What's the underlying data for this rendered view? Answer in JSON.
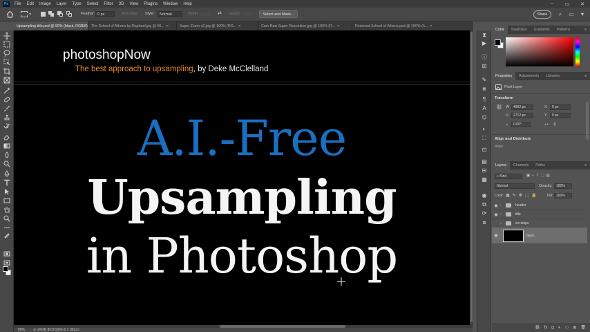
{
  "app": {
    "logo": "Ps"
  },
  "menubar": {
    "items": [
      "File",
      "Edit",
      "Image",
      "Layer",
      "Type",
      "Select",
      "Filter",
      "3D",
      "View",
      "Plugins",
      "Window",
      "Help"
    ]
  },
  "options": {
    "feather_label": "Feather:",
    "feather_value": "0 px",
    "antialias_label": "Anti-alias",
    "style_label": "Style:",
    "style_value": "Normal",
    "width_label": "Width:",
    "height_label": "Height:",
    "select_mask": "Select and Mask...",
    "share": "Share"
  },
  "tabs": [
    {
      "label": "Upsampling title.psd @ 50% (black, RGB/8)",
      "active": true
    },
    {
      "label": "The School of Athens by Raphael.jpg @ 66...",
      "active": false
    },
    {
      "label": "Super Zoom x2.jpg @ 100% (RG...",
      "active": false
    },
    {
      "label": "Cam Raw Super Resolution.jpg @ 100% (R...",
      "active": false
    },
    {
      "label": "Restored School of Athens.psd @ 100% (h...",
      "active": false
    }
  ],
  "canvas": {
    "brand": "photoshopNow",
    "tagline_orange": "The best approach to upsampling",
    "tagline_rest": ", by Deke McClelland",
    "headline1": "A.I.-Free",
    "headline2": "Upsampling",
    "headline3": "in Photoshop"
  },
  "status": {
    "zoom": "50%",
    "info": "◎ sRGB IEC61966-2.1 (8bpc)"
  },
  "color_panel": {
    "tabs": [
      "Color",
      "Swatches",
      "Gradients",
      "Patterns"
    ]
  },
  "properties_panel": {
    "tabs": [
      "Properties",
      "Adjustments",
      "Libraries"
    ],
    "type": "Pixel Layer",
    "transform_title": "Transform",
    "w_label": "W",
    "w_value": "4992 px",
    "h_label": "H",
    "h_value": "2712 px",
    "x_label": "X",
    "x_value": "0 px",
    "y_label": "Y",
    "y_value": "0 px",
    "angle_value": "0.00°",
    "align_title": "Align and Distribute",
    "align_label": "Align:"
  },
  "layers_panel": {
    "tabs": [
      "Layers",
      "Channels",
      "Paths"
    ],
    "kind_label": "Kind",
    "blend_mode": "Normal",
    "opacity_label": "Opacity:",
    "opacity_value": "100%",
    "lock_label": "Lock:",
    "fill_label": "Fill:",
    "fill_value": "100%",
    "layers": [
      {
        "name": "header",
        "group": true
      },
      {
        "name": "title",
        "group": true
      },
      {
        "name": "six steps",
        "group": true
      },
      {
        "name": "black",
        "group": false
      }
    ]
  },
  "colors": {
    "accent_blue": "#1a6fc1",
    "tagline_orange": "#e8892e"
  }
}
